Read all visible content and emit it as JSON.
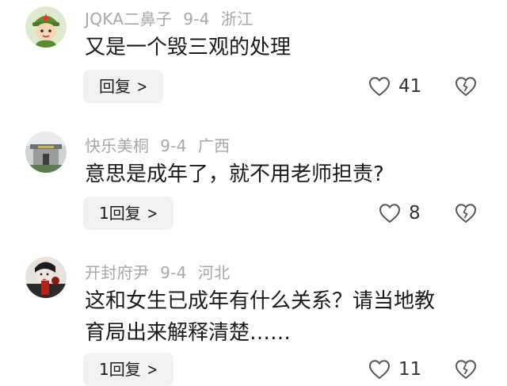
{
  "comments": [
    {
      "username": "JQKA二鼻子",
      "date": "9-4",
      "location": "浙江",
      "lines": [
        "又是一个毁三观的处理"
      ],
      "reply_label": "回复",
      "likes": "41"
    },
    {
      "username": "快乐美桐",
      "date": "9-4",
      "location": "广西",
      "lines": [
        "意思是成年了，就不用老师担责?"
      ],
      "reply_label": "1回复",
      "likes": "8"
    },
    {
      "username": "开封府尹",
      "date": "9-4",
      "location": "河北",
      "lines": [
        "这和女生已成年有什么关系？请当地教",
        "育局出来解释清楚……"
      ],
      "reply_label": "1回复",
      "likes": "11"
    }
  ],
  "colors": {
    "meta_text": "#a7a7a7",
    "reply_bg": "#f2f2f2",
    "icon_stroke": "#555555"
  },
  "icons": {
    "avatar_1": "cartoon-soldier-avatar",
    "avatar_2": "gate-photo-avatar",
    "avatar_3": "opera-figure-avatar",
    "like": "heart-outline-icon",
    "dislike": "broken-heart-icon",
    "reply_chevron": "chevron-right-icon"
  }
}
